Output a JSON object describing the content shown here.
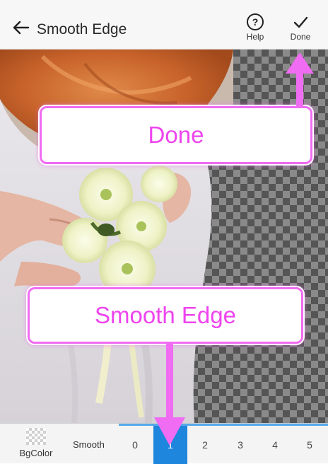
{
  "toolbar": {
    "title": "Smooth Edge",
    "help_label": "Help",
    "done_label": "Done"
  },
  "callouts": {
    "done": "Done",
    "smooth_edge": "Smooth Edge"
  },
  "bottom_bar": {
    "bgcolor_label": "BgColor",
    "smooth_label": "Smooth",
    "levels": [
      "0",
      "1",
      "2",
      "3",
      "4",
      "5"
    ],
    "selected_level": "1"
  },
  "colors": {
    "accent_pink": "#f06cf2",
    "selected_blue": "#1f86dd"
  },
  "icons": {
    "back": "back-arrow-icon",
    "help": "help-circle-icon",
    "done": "check-icon"
  }
}
